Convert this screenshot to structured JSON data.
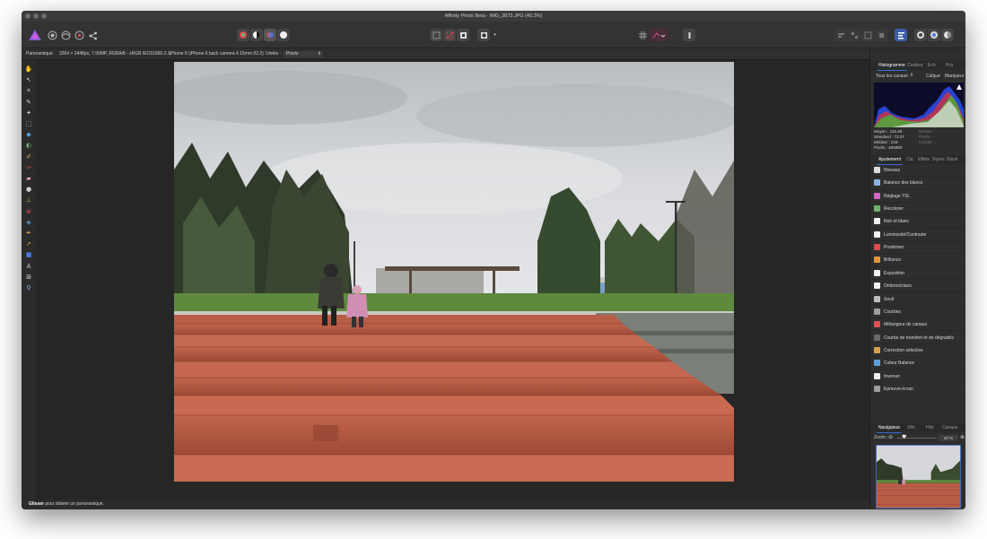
{
  "window": {
    "title": "Affinity Photo Beta - IMG_3873.JPG (40.3%)"
  },
  "toolbar": {
    "icons": [
      "affinity-photo-logo",
      "photo-persona-icon",
      "liquify-persona-icon",
      "develop-persona-icon",
      "export-persona-icon",
      "auto-levels-icon",
      "auto-contrast-icon",
      "auto-colour-icon",
      "auto-white-balance-icon",
      "marquee-icon",
      "deselect-icon",
      "invert-selection-icon",
      "quick-mask-icon",
      "snapping-icon",
      "assistant-icon",
      "arrange-icon",
      "studio-icons"
    ]
  },
  "context": {
    "tool_name": "Panoramique",
    "image_info": "3264 × 2448px, 7.99MP, RGBA/8 - sRGB IEC61966-2.1",
    "camera_info": "iPhone 6 (iPhone 6 back camera 4.15mm f/2.2)",
    "unit_label": "Unités :",
    "unit_value": "Pixels"
  },
  "tools": [
    "hand-tool-icon",
    "move-tool-icon",
    "crop-tool-icon",
    "selection-brush-icon",
    "flood-select-icon",
    "marquee-tool-icon",
    "flood-fill-icon",
    "gradient-icon",
    "paint-brush-icon",
    "colour-replacement-icon",
    "erase-brush-icon",
    "dodge-icon",
    "clone-icon",
    "red-eye-icon",
    "blur-brush-icon",
    "pen-tool-icon",
    "node-tool-icon",
    "rectangle-tool-icon",
    "artistic-text-icon",
    "mesh-warp-icon",
    "zoom-tool-icon"
  ],
  "status": {
    "bold": "Glisser",
    "text": " pour obtenir un panoramique."
  },
  "histogram_panel": {
    "tabs": [
      "Histogramme",
      "Couleur",
      "Ech",
      "Pcs"
    ],
    "active_tab": "Histogramme",
    "channel_select": "Tous les canaux",
    "calque_label": "Calque",
    "marker_label": "Marqueur",
    "stats_left": [
      "Moyen : 115.45",
      "Standard : 73.07",
      "Médian : 218",
      "Pixels : 496990"
    ],
    "stats_right": [
      "Niveau : -",
      "Pixels : -",
      "Centile : -"
    ]
  },
  "adjustment_panel": {
    "tabs": [
      "Ajustement",
      "Clq",
      "Effets",
      "Styles",
      "Stock"
    ],
    "active_tab": "Ajustement",
    "items": [
      {
        "label": "Niveaux",
        "color": "#dcdcdc"
      },
      {
        "label": "Balance des blancs",
        "color": "#8ab4e8"
      },
      {
        "label": "Réglage TSL",
        "color": "#d965c9"
      },
      {
        "label": "Recolorer",
        "color": "#6db36d"
      },
      {
        "label": "Noir et blanc",
        "color": "#f0f0f0"
      },
      {
        "label": "Luminosité/Contraste",
        "color": "#f0f0f0"
      },
      {
        "label": "Postériser",
        "color": "#e04a4a"
      },
      {
        "label": "Brillance",
        "color": "#e8953a"
      },
      {
        "label": "Exposition",
        "color": "#f0f0f0"
      },
      {
        "label": "Ombres/clairs",
        "color": "#f0f0f0"
      },
      {
        "label": "Seuil",
        "color": "#bdbdbd"
      },
      {
        "label": "Courbes",
        "color": "#9e9e9e"
      },
      {
        "label": "Mélangeur de canaux",
        "color": "#e05050"
      },
      {
        "label": "Courbe de transfert et de dégradés",
        "color": "#6a6a6a"
      },
      {
        "label": "Correction sélective",
        "color": "#d9a04a"
      },
      {
        "label": "Colour Balance",
        "color": "#5aa0e0"
      },
      {
        "label": "Inverser",
        "color": "#f0f0f0"
      },
      {
        "label": "Epreuve-écran",
        "color": "#9e9e9e"
      }
    ]
  },
  "navigator_panel": {
    "tabs": [
      "Navigateur",
      "Xfm",
      "Hist",
      "Canaux"
    ],
    "active_tab": "Navigateur",
    "zoom_label": "Zoom :",
    "zoom_value": "40 %"
  },
  "colors": {
    "accent": "#3b6ad1",
    "panel_bg": "#2e2e2e",
    "canvas_bg": "#262626"
  }
}
